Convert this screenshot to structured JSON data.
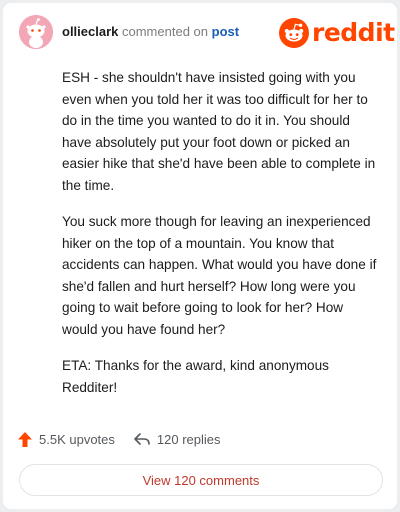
{
  "comment": {
    "username": "ollieclark",
    "action_text": "commented on",
    "target_link": "post",
    "avatar_icon": "reddit-snoo-avatar",
    "avatar_color": "#f3a6b5"
  },
  "brand": {
    "logo_icon": "reddit-snoo-icon",
    "name": "reddit",
    "color": "#ff4500"
  },
  "body": {
    "paragraphs": [
      "ESH - she shouldn't have insisted going with you even when you told her it was too difficult for her to do in the time you wanted to do it in. You should have absolutely put your foot down or picked an easier hike that she'd have been able to complete in the time.",
      "You suck more though for leaving an inexperienced hiker on the top of a mountain. You know that accidents can happen. What would you have done if she'd fallen and hurt herself? How long were you going to wait before going to look for her? How would you have found her?",
      "ETA: Thanks for the award, kind anonymous Redditer!"
    ]
  },
  "actions": {
    "upvotes_label": "5.5K upvotes",
    "upvote_icon": "upvote-arrow-icon",
    "upvote_color": "#ff4500",
    "replies_label": "120 replies",
    "reply_icon": "reply-arrow-icon"
  },
  "view_comments": {
    "label": "View 120 comments",
    "color": "#c0392b"
  }
}
